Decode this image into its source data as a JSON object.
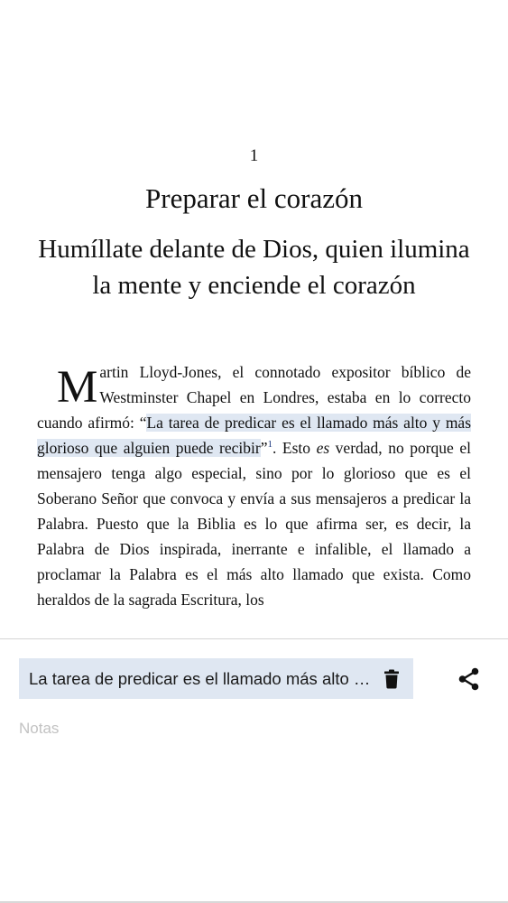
{
  "reader": {
    "chapter_number": "1",
    "chapter_title": "Preparar el corazón",
    "chapter_subtitle": "Humíllate delante de Dios, quien ilumina la mente y enciende el corazón",
    "drop_cap": "M",
    "paragraph_start": "artin Lloyd-Jones, el connotado expositor bíblico de Westminster Chapel en Londres, estaba en lo correcto cuando afirmó: “",
    "highlighted_quote": "La tarea de predicar es el llamado más alto y más glorioso que alguien puede recibir",
    "quote_close": "”",
    "footnote_marker": "1",
    "text_before_em": ". Esto ",
    "emphasis_word": "es",
    "paragraph_end": " verdad, no porque el mensajero tenga algo especial, sino por lo glorioso que es el Soberano Señor que convoca y envía a sus mensajeros a predicar la Palabra. Puesto que la Biblia es lo que afirma ser, es decir, la Palabra de Dios inspirada, inerrante e infalible, el llamado a proclamar la Palabra es el más alto llamado que exista. Como heraldos de la sagrada Escritura, los"
  },
  "annotation_panel": {
    "highlight_excerpt": "La tarea de predicar es el llamado más alto y más glorioso que alguien puede recibir",
    "delete_icon": "trash-icon",
    "share_icon": "share-icon",
    "notes_placeholder": "Notas",
    "notes_value": "",
    "highlight_color": "#dfe7f2"
  }
}
